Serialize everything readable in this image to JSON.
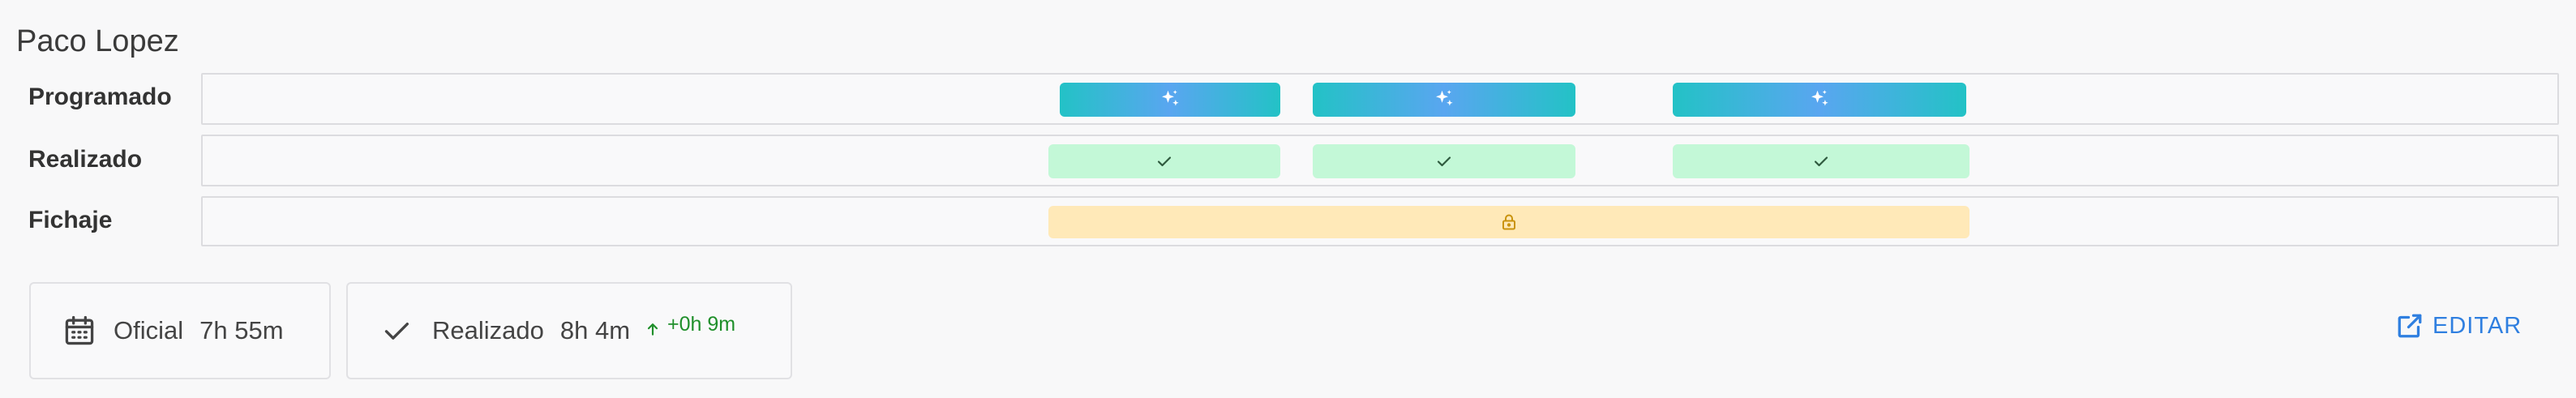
{
  "employee": {
    "name": "Paco Lopez"
  },
  "rows": [
    {
      "label": "Programado"
    },
    {
      "label": "Realizado"
    },
    {
      "label": "Fichaje"
    }
  ],
  "blocks": {
    "programado": {
      "count": 3,
      "icon": "sparkles-icon",
      "color": "#3bb8d6"
    },
    "realizado": {
      "count": 3,
      "icon": "check-icon",
      "color": "#c3f8d7"
    },
    "fichaje": {
      "count": 1,
      "icon": "lock-icon",
      "color": "#ffe9b8"
    }
  },
  "summary": {
    "official": {
      "label": "Oficial",
      "value": "7h 55m",
      "icon": "calendar-icon"
    },
    "done": {
      "label": "Realizado",
      "value": "8h 4m",
      "icon": "check-icon",
      "delta": "+0h 9m",
      "delta_color": "#1f8f2a"
    }
  },
  "edit_button": {
    "label": "EDITAR",
    "icon": "external-edit-icon",
    "color": "#2f7fe0"
  }
}
